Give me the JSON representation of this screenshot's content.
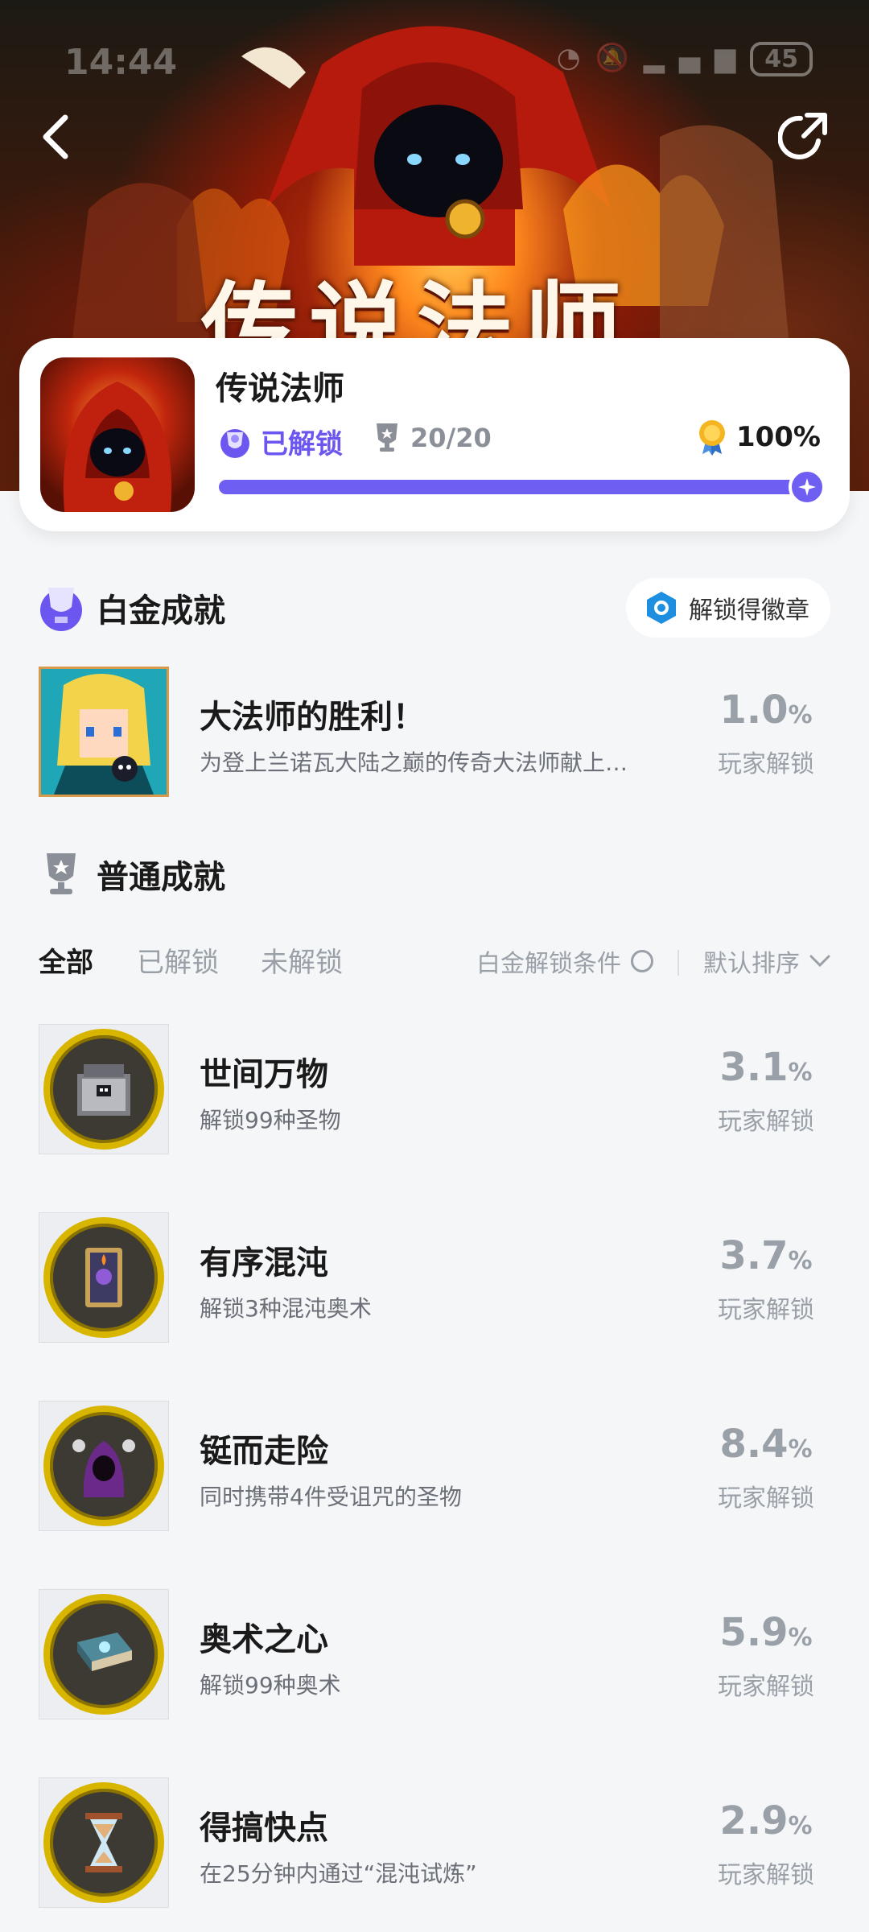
{
  "status_bar": {
    "time": "14:44",
    "battery": "45"
  },
  "game": {
    "hero_title": "传说法师",
    "name": "传说法师",
    "unlock_state": "已解锁",
    "trophies": "20/20",
    "completion": "100%",
    "progress": 1.0
  },
  "platinum": {
    "section_title": "白金成就",
    "badge_button": "解锁得徽章",
    "item": {
      "title": "大法师的胜利！",
      "desc": "为登上兰诺瓦大陆之巅的传奇大法师献上…",
      "pct": "1.0",
      "pct_unit": "%",
      "pct_label": "玩家解锁"
    }
  },
  "normal": {
    "section_title": "普通成就",
    "tabs": [
      "全部",
      "已解锁",
      "未解锁"
    ],
    "condition": "白金解锁条件",
    "sort": "默认排序",
    "items": [
      {
        "title": "世间万物",
        "desc": "解锁99种圣物",
        "pct": "3.1",
        "unit": "%",
        "label": "玩家解锁",
        "icon": "chest-icon"
      },
      {
        "title": "有序混沌",
        "desc": "解锁3种混沌奥术",
        "pct": "3.7",
        "unit": "%",
        "label": "玩家解锁",
        "icon": "arcana-card-icon"
      },
      {
        "title": "铤而走险",
        "desc": "同时携带4件受诅咒的圣物",
        "pct": "8.4",
        "unit": "%",
        "label": "玩家解锁",
        "icon": "cursed-wizard-icon"
      },
      {
        "title": "奥术之心",
        "desc": "解锁99种奥术",
        "pct": "5.9",
        "unit": "%",
        "label": "玩家解锁",
        "icon": "spellbook-icon"
      },
      {
        "title": "得搞快点",
        "desc": "在25分钟内通过“混沌试炼”",
        "pct": "2.9",
        "unit": "%",
        "label": "玩家解锁",
        "icon": "hourglass-icon"
      }
    ]
  },
  "colors": {
    "accent": "#6e5ef2",
    "gold": "#d8b600",
    "muted": "#9aa0a8"
  }
}
